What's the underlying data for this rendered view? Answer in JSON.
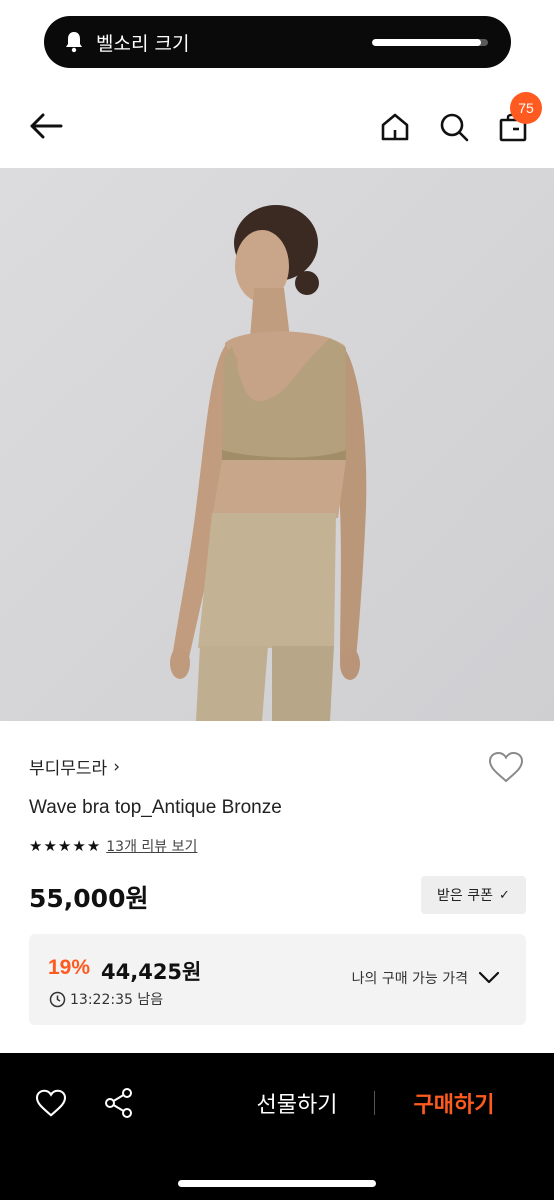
{
  "hud": {
    "label": "벨소리 크기",
    "icon": "bell-icon",
    "volume_percent": 94
  },
  "header": {
    "back_icon": "arrow-left-icon",
    "home_icon": "home-icon",
    "search_icon": "search-icon",
    "bag_icon": "shopping-bag-icon",
    "cart_count": "75"
  },
  "product": {
    "brand": "부디무드라",
    "brand_chevron": "›",
    "name": "Wave bra top_Antique Bronze",
    "rating_stars": 5,
    "review_link": "13개 리뷰 보기",
    "price": "55,000원",
    "coupon_label": "받은 쿠폰",
    "coupon_check": "✓",
    "discount": {
      "rate": "19%",
      "price": "44,425원",
      "timer": "13:22:35 남음",
      "my_price_label": "나의 구매 가능 가격"
    }
  },
  "bottom_bar": {
    "gift_label": "선물하기",
    "buy_label": "구매하기",
    "heart_icon": "heart-outline-icon",
    "share_icon": "share-icon"
  },
  "colors": {
    "accent": "#ff5a1f",
    "image_bg": "#d8d8da",
    "garment": "#b4a07c",
    "bottom_bar": "#000000"
  }
}
